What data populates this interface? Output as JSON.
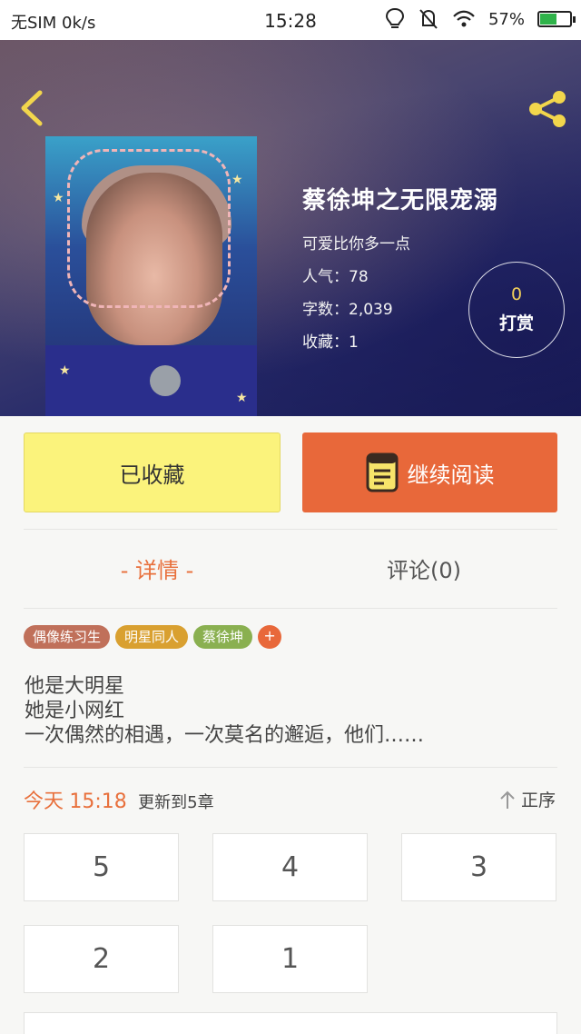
{
  "status_bar": {
    "carrier": "无SIM",
    "speed": "0k/s",
    "time": "15:28",
    "battery_percent": "57%",
    "battery_level": 0.57
  },
  "book": {
    "title": "蔡徐坤之无限宠溺",
    "author": "可爱比你多一点",
    "popularity_label": "人气：",
    "popularity": "78",
    "words_label": "字数：",
    "words": "2,039",
    "favorites_label": "收藏：",
    "favorites": "1"
  },
  "tip": {
    "count": "0",
    "label": "打赏"
  },
  "actions": {
    "collect": "已收藏",
    "read": "继续阅读"
  },
  "tabs": {
    "detail": "- 详情 -",
    "comments": "评论(0)"
  },
  "tags": [
    {
      "label": "偶像练习生",
      "color": "#c0705a"
    },
    {
      "label": "明星同人",
      "color": "#d9a030"
    },
    {
      "label": "蔡徐坤",
      "color": "#8ab050"
    }
  ],
  "tag_add": "+",
  "summary": [
    "他是大明星",
    "她是小网红",
    "一次偶然的相遇，一次莫名的邂逅，他们……"
  ],
  "update": {
    "day": "今天",
    "time": "15:18",
    "text": "更新到5章"
  },
  "sort_label": "正序",
  "chapters": [
    "5",
    "4",
    "3",
    "2",
    "1"
  ],
  "colors": {
    "accent": "#e8683a",
    "collect": "#fbf37c"
  },
  "icons": {
    "back": "chevron-left-icon",
    "share": "share-icon",
    "book": "book-icon",
    "sort": "arrow-up-icon"
  }
}
